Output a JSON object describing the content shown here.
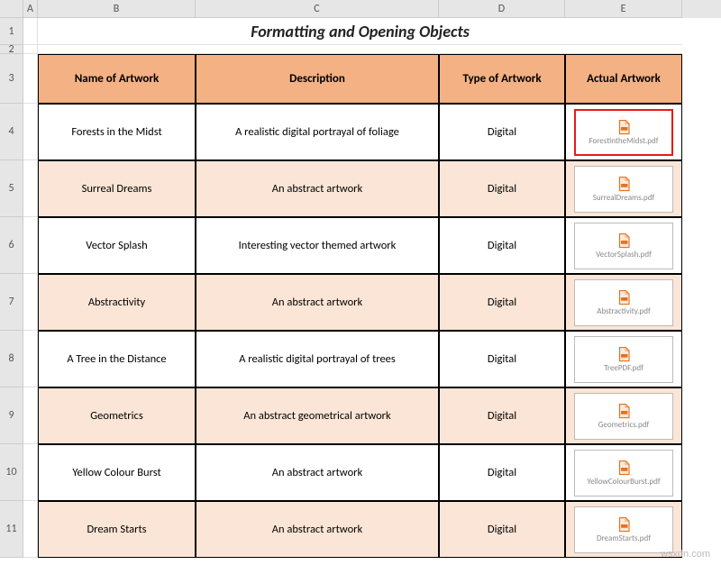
{
  "columns": [
    "A",
    "B",
    "C",
    "D",
    "E"
  ],
  "rowNumbers": [
    "1",
    "2",
    "3",
    "4",
    "5",
    "6",
    "7",
    "8",
    "9",
    "10",
    "11"
  ],
  "title": "Formatting and Opening Objects",
  "headers": {
    "name": "Name of Artwork",
    "desc": "Description",
    "type": "Type of Artwork",
    "actual": "Actual Artwork"
  },
  "rows": [
    {
      "name": "Forests in the Midst",
      "desc": "A realistic digital portrayal of  foliage",
      "type": "Digital",
      "file": "ForestintheMidst.pdf",
      "highlight": true
    },
    {
      "name": "Surreal Dreams",
      "desc": "An abstract artwork",
      "type": "Digital",
      "file": "SurrealDreams.pdf",
      "highlight": false
    },
    {
      "name": "Vector Splash",
      "desc": "Interesting vector themed artwork",
      "type": "Digital",
      "file": "VectorSplash.pdf",
      "highlight": false
    },
    {
      "name": "Abstractivity",
      "desc": "An abstract artwork",
      "type": "Digital",
      "file": "Abstractivity.pdf",
      "highlight": false
    },
    {
      "name": "A Tree in the Distance",
      "desc": "A realistic digital portrayal of trees",
      "type": "Digital",
      "file": "TreePDF.pdf",
      "highlight": false
    },
    {
      "name": "Geometrics",
      "desc": "An abstract geometrical artwork",
      "type": "Digital",
      "file": "Geometrics.pdf",
      "highlight": false
    },
    {
      "name": "Yellow Colour Burst",
      "desc": "An abstract artwork",
      "type": "Digital",
      "file": "YellowColourBurst.pdf",
      "highlight": false
    },
    {
      "name": "Dream Starts",
      "desc": "An abstract artwork",
      "type": "Digital",
      "file": "DreamStarts.pdf",
      "highlight": false
    }
  ],
  "watermark": "wsxdn.com"
}
